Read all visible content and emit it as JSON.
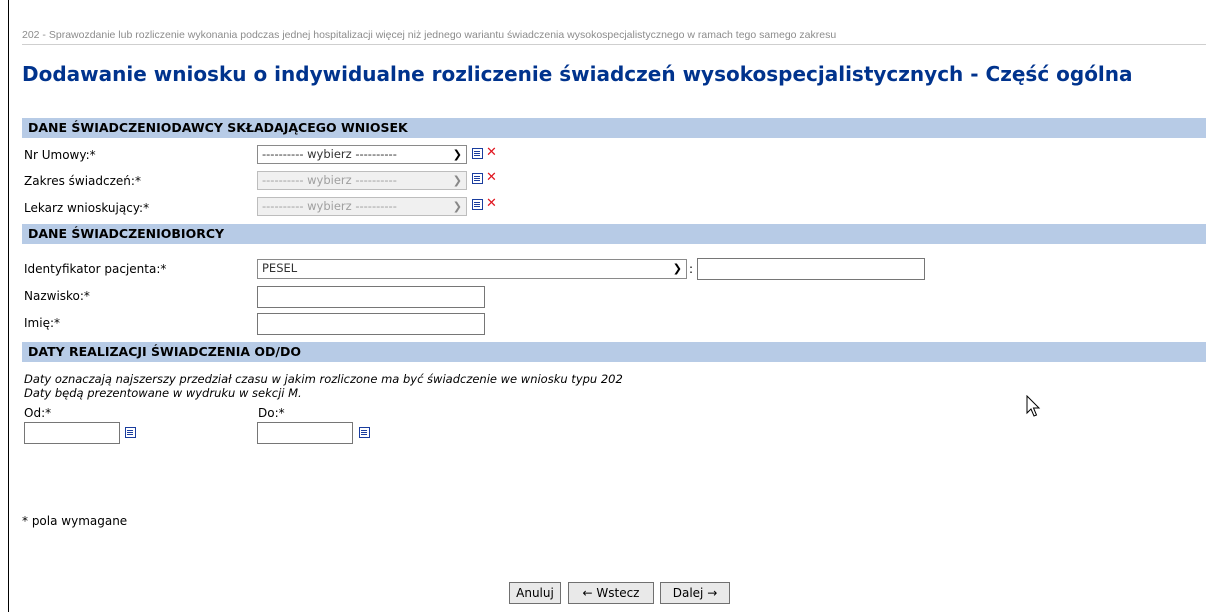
{
  "breadcrumb": "202 - Sprawozdanie lub rozliczenie wykonania podczas jednej hospitalizacji więcej niż jednego wariantu świadczenia wysokospecjalistycznego w ramach tego samego zakresu",
  "page_title": "Dodawanie wniosku o indywidualne rozliczenie świadczeń wysokospecjalistycznych - Część ogólna",
  "provider_section": {
    "header": "DANE ŚWIADCZENIODAWCY SKŁADAJĄCEGO WNIOSEK",
    "fields": [
      {
        "label": "Nr Umowy:*",
        "value": "---------- wybierz ----------",
        "disabled": false
      },
      {
        "label": "Zakres świadczeń:*",
        "value": "---------- wybierz ----------",
        "disabled": true
      },
      {
        "label": "Lekarz wnioskujący:*",
        "value": "---------- wybierz ----------",
        "disabled": true
      }
    ]
  },
  "patient_section": {
    "header": "DANE ŚWIADCZENIOBIORCY",
    "identifier_label": "Identyfikator pacjenta:*",
    "identifier_type": "PESEL",
    "identifier_value": "",
    "surname_label": "Nazwisko:*",
    "surname_value": "",
    "firstname_label": "Imię:*",
    "firstname_value": ""
  },
  "dates_section": {
    "header": "DATY REALIZACJI ŚWIADCZENIA OD/DO",
    "note_1": "Daty oznaczają najszerszy przedział czasu w jakim rozliczone ma być świadczenie we wniosku typu 202",
    "note_2": "Daty będą prezentowane w wydruku w sekcji M.",
    "from_label": "Od:*",
    "from_value": "",
    "to_label": "Do:*",
    "to_value": ""
  },
  "required_note": "* pola wymagane",
  "buttons": {
    "cancel": "Anuluj",
    "back": "← Wstecz",
    "next": "Dalej →"
  },
  "colors": {
    "title": "#00338d",
    "section_header_bg": "#b7cbe6",
    "delete_icon": "#e0141e"
  }
}
